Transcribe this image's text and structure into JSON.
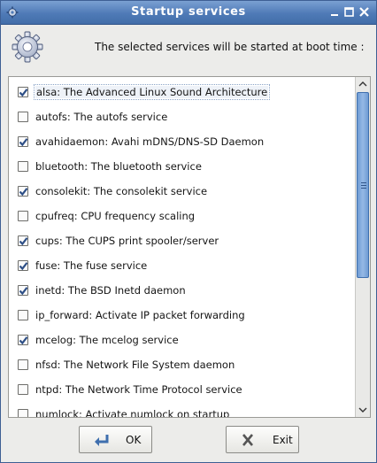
{
  "window": {
    "title": "Startup services"
  },
  "header": {
    "message": "The selected services will be started at boot time :"
  },
  "services": [
    {
      "label": "alsa: The Advanced Linux Sound Architecture",
      "checked": true,
      "focused": true
    },
    {
      "label": "autofs: The autofs service",
      "checked": false
    },
    {
      "label": "avahidaemon: Avahi mDNS/DNS-SD Daemon",
      "checked": true
    },
    {
      "label": "bluetooth: The bluetooth service",
      "checked": false
    },
    {
      "label": "consolekit: The consolekit service",
      "checked": true
    },
    {
      "label": "cpufreq: CPU frequency scaling",
      "checked": false
    },
    {
      "label": "cups: The CUPS print spooler/server",
      "checked": true
    },
    {
      "label": "fuse: The fuse service",
      "checked": true
    },
    {
      "label": "inetd: The BSD Inetd daemon",
      "checked": true
    },
    {
      "label": "ip_forward: Activate IP packet forwarding",
      "checked": false
    },
    {
      "label": "mcelog: The mcelog service",
      "checked": true
    },
    {
      "label": "nfsd: The Network File System daemon",
      "checked": false
    },
    {
      "label": "ntpd: The Network Time Protocol service",
      "checked": false
    },
    {
      "label": "numlock: Activate numlock on startup",
      "checked": false
    }
  ],
  "buttons": {
    "ok": "OK",
    "exit": "Exit"
  },
  "colors": {
    "titlebar": "#4f7ab7",
    "accent": "#6f9bd3",
    "check": "#2e4f86"
  }
}
